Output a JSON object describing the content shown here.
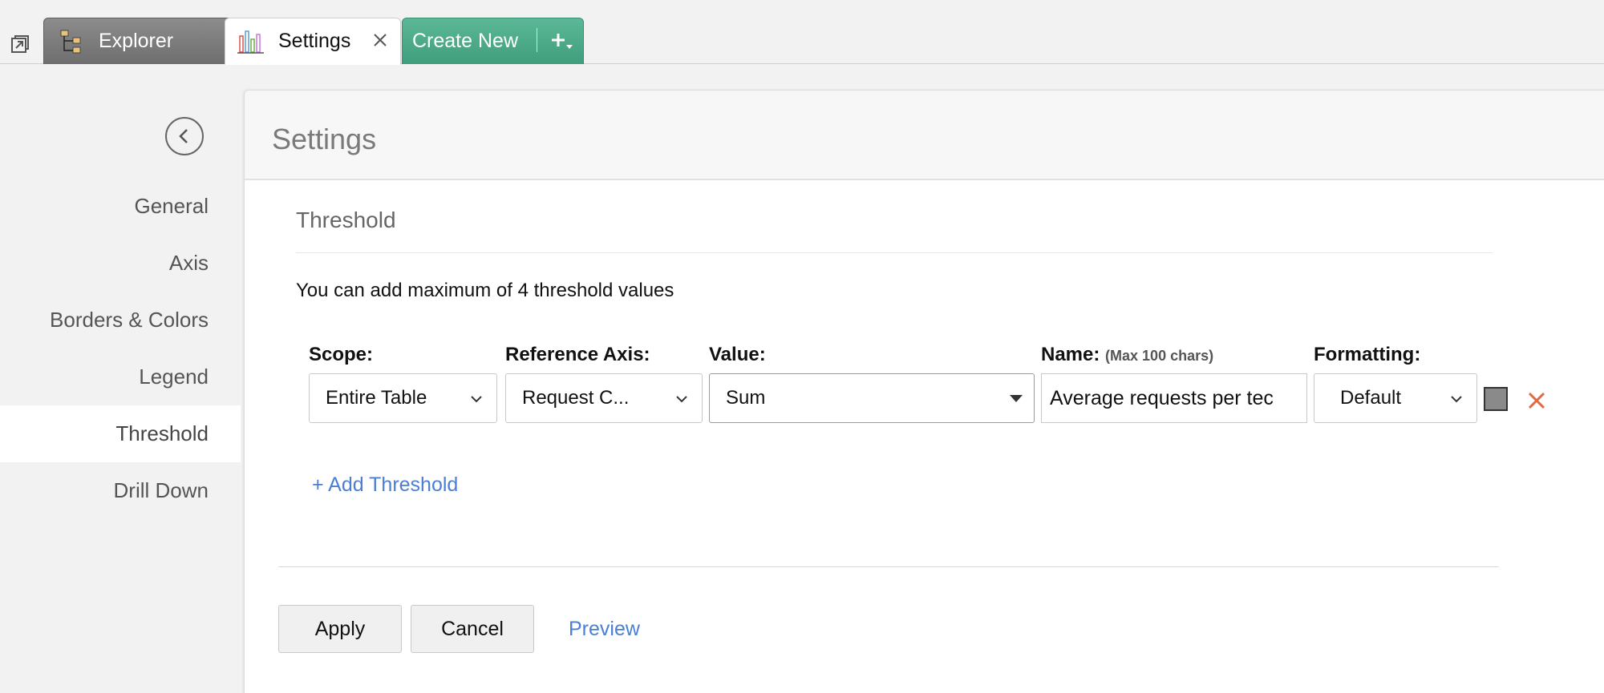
{
  "tabs": {
    "explorer": {
      "label": "Explorer",
      "icon": "hierarchy-icon"
    },
    "settings": {
      "label": "Settings",
      "icon": "bar-chart-icon"
    },
    "create_new": {
      "label": "Create New",
      "icon": "plus-dropdown-icon"
    }
  },
  "sidebar": {
    "items": [
      {
        "label": "General"
      },
      {
        "label": "Axis"
      },
      {
        "label": "Borders & Colors"
      },
      {
        "label": "Legend"
      },
      {
        "label": "Threshold",
        "active": true
      },
      {
        "label": "Drill Down"
      }
    ]
  },
  "panel": {
    "title": "Settings",
    "section_title": "Threshold",
    "info": "You can add maximum of 4 threshold values"
  },
  "threshold_row": {
    "scope_label": "Scope:",
    "scope_value": "Entire Table",
    "ref_axis_label": "Reference Axis:",
    "ref_axis_value": "Request C...",
    "value_label": "Value:",
    "value_value": "Sum",
    "name_label": "Name:",
    "name_hint": "(Max 100 chars)",
    "name_value": "Average requests per tec",
    "formatting_label": "Formatting:",
    "formatting_value": "Default",
    "swatch_color": "#8a8a8a",
    "remove_color": "#e06a45"
  },
  "actions": {
    "add_threshold": "+ Add Threshold",
    "apply": "Apply",
    "cancel": "Cancel",
    "preview": "Preview"
  },
  "colors": {
    "accent_link": "#4a7fd4",
    "create_tab": "#4aa886"
  }
}
